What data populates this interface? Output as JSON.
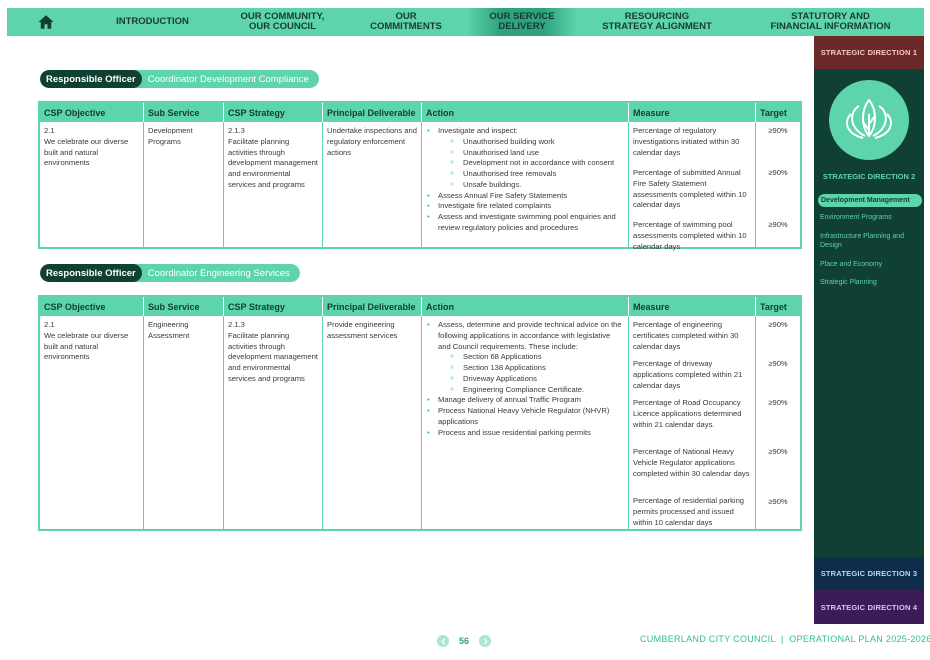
{
  "nav": {
    "items": [
      {
        "label": "INTRODUCTION"
      },
      {
        "label": "OUR COMMUNITY,\nOUR COUNCIL"
      },
      {
        "label": "OUR\nCOMMITMENTS"
      },
      {
        "label": "OUR SERVICE\nDELIVERY"
      },
      {
        "label": "RESOURCING\nSTRATEGY ALIGNMENT"
      },
      {
        "label": "STATUTORY AND\nFINANCIAL INFORMATION"
      }
    ],
    "active": "OUR SERVICE DELIVERY"
  },
  "sidebar": {
    "dir1": "STRATEGIC DIRECTION 1",
    "dir2": "STRATEGIC DIRECTION 2",
    "dir3": "STRATEGIC DIRECTION 3",
    "dir4": "STRATEGIC DIRECTION 4",
    "active_item": "Development Management",
    "items": [
      "Environment Programs",
      "Infrastructure Planning and Design",
      "Place and Economy",
      "Strategic Planning"
    ]
  },
  "headers": [
    "CSP Objective",
    "Sub Service",
    "CSP Strategy",
    "Principal Deliverable",
    "Action",
    "Measure",
    "Target"
  ],
  "sections": [
    {
      "officer_label": "Responsible Officer",
      "officer": "Coordinator Development Compliance",
      "csp_objective": "2.1\nWe celebrate our diverse built and natural environments",
      "sub_service": "Development Programs",
      "csp_strategy": "2.1.3\nFacilitate planning activities through development management and environmental services and programs",
      "deliverable": "Undertake inspections and regulatory enforcement actions",
      "actions": [
        {
          "text": "Investigate and inspect:",
          "sub": [
            "Unauthorised building work",
            "Unauthorised land use",
            "Development not in accordance with consent",
            "Unauthorised tree removals",
            "Unsafe buildings."
          ]
        },
        {
          "text": "Assess Annual Fire Safety Statements",
          "sub": []
        },
        {
          "text": "Investigate fire related complaints",
          "sub": []
        },
        {
          "text": "Assess and investigate swimming pool enquiries and review regulatory policies and procedures",
          "sub": []
        }
      ],
      "measures": [
        "Percentage of regulatory investigations initiated within 30 calendar days",
        "Percentage of submitted Annual Fire Safety Statement assessments completed within 10 calendar days",
        "Percentage of swimming pool assessments completed within 10 calendar days"
      ],
      "targets": [
        "≥90%",
        "≥90%",
        "≥90%"
      ]
    },
    {
      "officer_label": "Responsible Officer",
      "officer": "Coordinator Engineering Services",
      "csp_objective": "2.1\nWe celebrate our diverse built and natural environments",
      "sub_service": "Engineering Assessment",
      "csp_strategy": "2.1.3\nFacilitate planning activities through development management and environmental services and programs",
      "deliverable": "Provide engineering assessment services",
      "actions": [
        {
          "text": "Assess, determine and provide technical advice on the following applications in accordance with legislative and Council requirements. These include:",
          "sub": [
            "Section 68 Applications",
            "Section 138 Applications",
            "Driveway Applications",
            "Engineering Compliance Certificate."
          ]
        },
        {
          "text": "Manage delivery of annual Traffic Program",
          "sub": []
        },
        {
          "text": "Process National Heavy Vehicle Regulator (NHVR) applications",
          "sub": []
        },
        {
          "text": "Process and issue residential parking permits",
          "sub": []
        }
      ],
      "measures": [
        "Percentage of engineering certificates completed within 30 calendar days",
        "Percentage of driveway applications completed within 21 calendar days",
        "Percentage of Road Occupancy Licence applications determined within 21 calendar days.",
        "Percentage of National Heavy Vehicle Regulator applications completed within 30 calendar days",
        "Percentage of residential parking permits processed and issued within 10 calendar days"
      ],
      "targets": [
        "≥90%",
        "≥90%",
        "≥90%",
        "≥90%",
        "≥90%"
      ]
    }
  ],
  "footer": {
    "page": "56",
    "text": "CUMBERLAND CITY COUNCIL  |  OPERATIONAL PLAN 2025-2026"
  },
  "colors": {
    "accent": "#5dd4ac",
    "dark": "#103f33",
    "dir1": "#6b2a29",
    "dir3": "#0f2c4a",
    "dir4": "#3c1c58"
  },
  "icons": [
    "home-icon",
    "lotus-leaf-icon",
    "chevron-left-icon",
    "chevron-right-icon"
  ]
}
